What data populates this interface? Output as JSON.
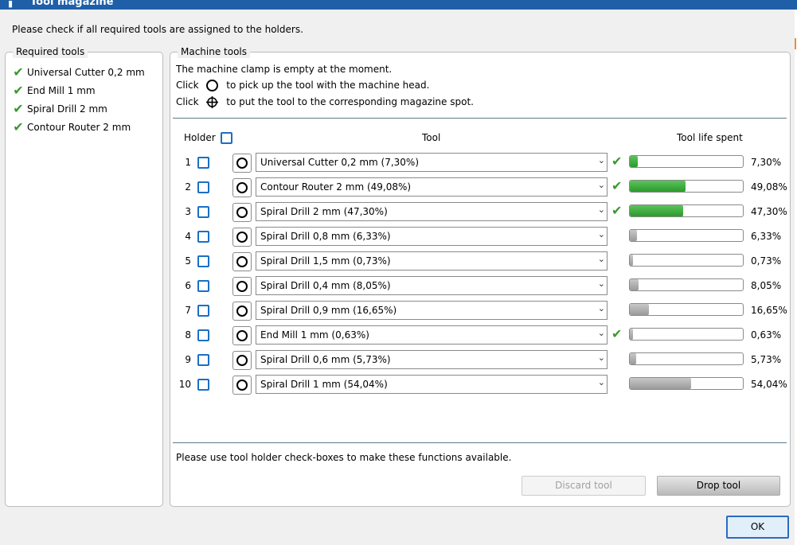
{
  "window": {
    "title": "Tool magazine"
  },
  "instruction": "Please check if all required tools are assigned to the holders.",
  "required": {
    "legend": "Required tools",
    "items": [
      {
        "label": "Universal Cutter 0,2 mm"
      },
      {
        "label": "End Mill 1 mm"
      },
      {
        "label": "Spiral Drill   2 mm"
      },
      {
        "label": "Contour Router 2 mm"
      }
    ]
  },
  "machine": {
    "legend": "Machine tools",
    "status": "The machine clamp is empty at the moment.",
    "click1_prefix": "Click",
    "click1_suffix": "to pick up the tool with the machine head.",
    "click2_prefix": "Click",
    "click2_suffix": "to put the tool to the corresponding magazine spot.",
    "header_holder": "Holder",
    "header_tool": "Tool",
    "header_life": "Tool life spent",
    "rows": [
      {
        "num": "1",
        "tool": "Universal Cutter 0,2 mm (7,30%)",
        "checked": true,
        "life": 0.073,
        "pct": "7,30%",
        "color": "green"
      },
      {
        "num": "2",
        "tool": "Contour Router 2 mm (49,08%)",
        "checked": true,
        "life": 0.4908,
        "pct": "49,08%",
        "color": "green"
      },
      {
        "num": "3",
        "tool": "Spiral Drill   2 mm (47,30%)",
        "checked": true,
        "life": 0.473,
        "pct": "47,30%",
        "color": "green"
      },
      {
        "num": "4",
        "tool": "Spiral Drill   0,8 mm (6,33%)",
        "checked": false,
        "life": 0.0633,
        "pct": "6,33%",
        "color": "grey"
      },
      {
        "num": "5",
        "tool": "Spiral Drill   1,5 mm (0,73%)",
        "checked": false,
        "life": 0.0073,
        "pct": "0,73%",
        "color": "grey"
      },
      {
        "num": "6",
        "tool": "Spiral Drill   0,4 mm (8,05%)",
        "checked": false,
        "life": 0.0805,
        "pct": "8,05%",
        "color": "grey"
      },
      {
        "num": "7",
        "tool": "Spiral Drill   0,9 mm (16,65%)",
        "checked": false,
        "life": 0.1665,
        "pct": "16,65%",
        "color": "grey"
      },
      {
        "num": "8",
        "tool": "End Mill 1 mm (0,63%)",
        "checked": true,
        "life": 0.0063,
        "pct": "0,63%",
        "color": "grey"
      },
      {
        "num": "9",
        "tool": "Spiral Drill   0,6 mm (5,73%)",
        "checked": false,
        "life": 0.0573,
        "pct": "5,73%",
        "color": "grey"
      },
      {
        "num": "10",
        "tool": "Spiral Drill   1 mm (54,04%)",
        "checked": false,
        "life": 0.5404,
        "pct": "54,04%",
        "color": "grey"
      }
    ],
    "notice": "Please use tool holder check-boxes to make these functions available.",
    "discard_label": "Discard tool",
    "drop_label": "Drop tool"
  },
  "ok_label": "OK",
  "colors": {
    "check": "#3a9a2e",
    "checkbox": "#1b6fc5",
    "title_bar": "#1f5fa8"
  }
}
